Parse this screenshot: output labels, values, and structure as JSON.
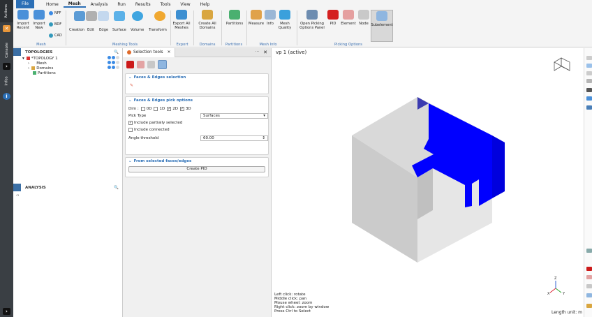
{
  "sidebar": {
    "tabs": [
      "Actions",
      "Console",
      "Infos"
    ]
  },
  "menu": {
    "items": [
      "File",
      "Home",
      "Mesh",
      "Analysis",
      "Run",
      "Results",
      "Tools",
      "View",
      "Help"
    ]
  },
  "ribbon": {
    "import_recent": "Import Recent",
    "import_new": "Import New",
    "nff": "NFF",
    "bdf": "BDF",
    "cad": "CAD",
    "creation": "Creation",
    "edit": "Edit",
    "edge": "Edge",
    "surface": "Surface",
    "volume": "Volume",
    "transform": "Transform",
    "export_all_meshes": "Export All Meshes",
    "create_all_domains": "Create All Domains",
    "partitions": "Partitions",
    "measure": "Measure",
    "info": "Info",
    "mesh_quality": "Mesh Quality",
    "open_picking_panel": "Open Picking Options Panel",
    "pid": "PID",
    "element": "Element",
    "node": "Node",
    "subelement": "Subelement",
    "groups": {
      "mesh": "Mesh",
      "meshing_tools": "Meshing Tools",
      "export": "Export",
      "domains": "Domains",
      "partitions": "Partitions",
      "mesh_info": "Mesh Info",
      "picking_options": "Picking Options"
    }
  },
  "topologies": {
    "title": "TOPOLOGIES",
    "items": [
      "*TOPOLOGY 1",
      "Mesh",
      "Domains",
      "Partitions"
    ]
  },
  "analysis": {
    "title": "ANALYSIS"
  },
  "selection": {
    "tab": "Selection tools",
    "sec1": "Faces & Edges selection",
    "sec2": "Faces & Edges pick options",
    "dim_label": "Dim :",
    "dims": [
      "0D",
      "1D",
      "2D",
      "3D"
    ],
    "pick_type_label": "Pick Type",
    "pick_type_value": "Surfaces",
    "include_partially": "Include partially selected",
    "include_connected": "Include connected",
    "angle_label": "Angle threshold",
    "angle_value": "60.00",
    "sec3": "From selected faces/edges",
    "create_pid": "Create PID"
  },
  "viewport": {
    "title": "vp 1 (active)",
    "hints": [
      "Left click: rotate",
      "Middle click: pan",
      "Mouse wheel: zoom",
      "Right click: zoom by window",
      "Press Ctrl to Select"
    ],
    "length_unit": "Length unit: m",
    "axis_labels": {
      "y": "Y",
      "x": "X",
      "z": "Z"
    }
  },
  "colors": {
    "accent": "#2b6fb6",
    "selection": "#0000ff",
    "cube_top": "#d9d9d9",
    "cube_left": "#cbcbcb",
    "cube_right": "#e6e6e6"
  }
}
